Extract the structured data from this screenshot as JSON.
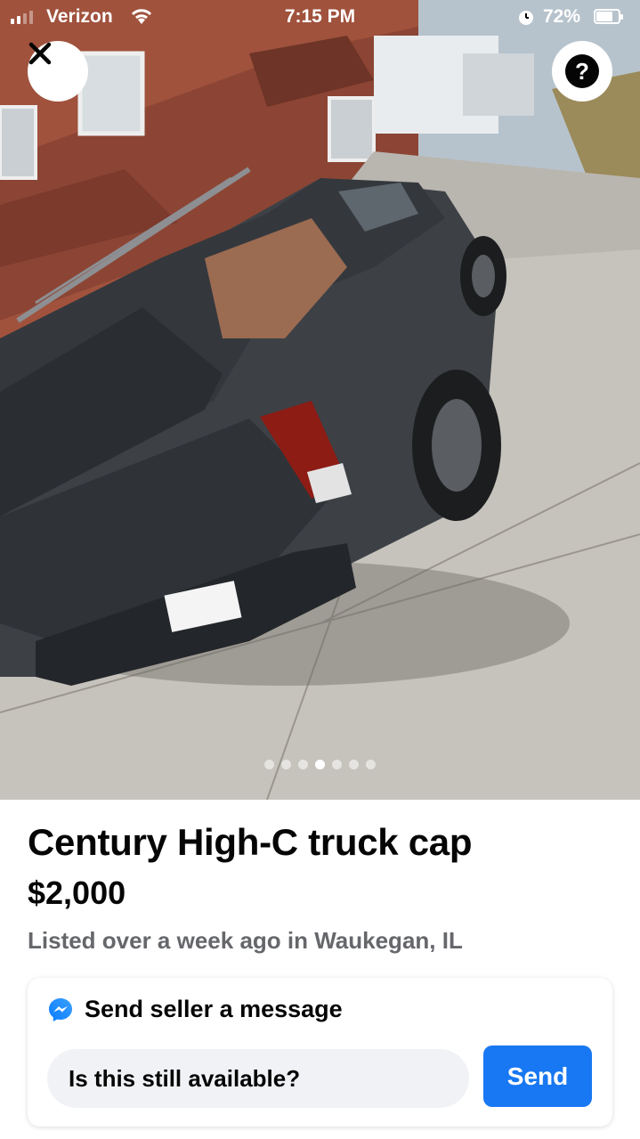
{
  "status_bar": {
    "carrier": "Verizon",
    "time": "7:15 PM",
    "battery_percent": "72%",
    "icons": [
      "signal-icon",
      "wifi-icon",
      "alarm-icon",
      "battery-icon"
    ]
  },
  "photo": {
    "description": "Gray pickup truck with truck cap parked on driveway",
    "close_icon": "close-icon",
    "help_icon": "help-icon",
    "help_glyph": "?",
    "pager": {
      "count": 7,
      "active_index": 3
    }
  },
  "listing": {
    "title": "Century High-C truck cap",
    "price": "$2,000",
    "listed": "Listed over a week ago in Waukegan, IL"
  },
  "message": {
    "heading": "Send seller a message",
    "input_value": "Is this still available?",
    "send_label": "Send",
    "messenger_icon": "messenger-icon"
  },
  "colors": {
    "accent": "#1877f2",
    "text_primary": "#050505",
    "text_secondary": "#65676b",
    "input_bg": "#f0f2f5"
  }
}
